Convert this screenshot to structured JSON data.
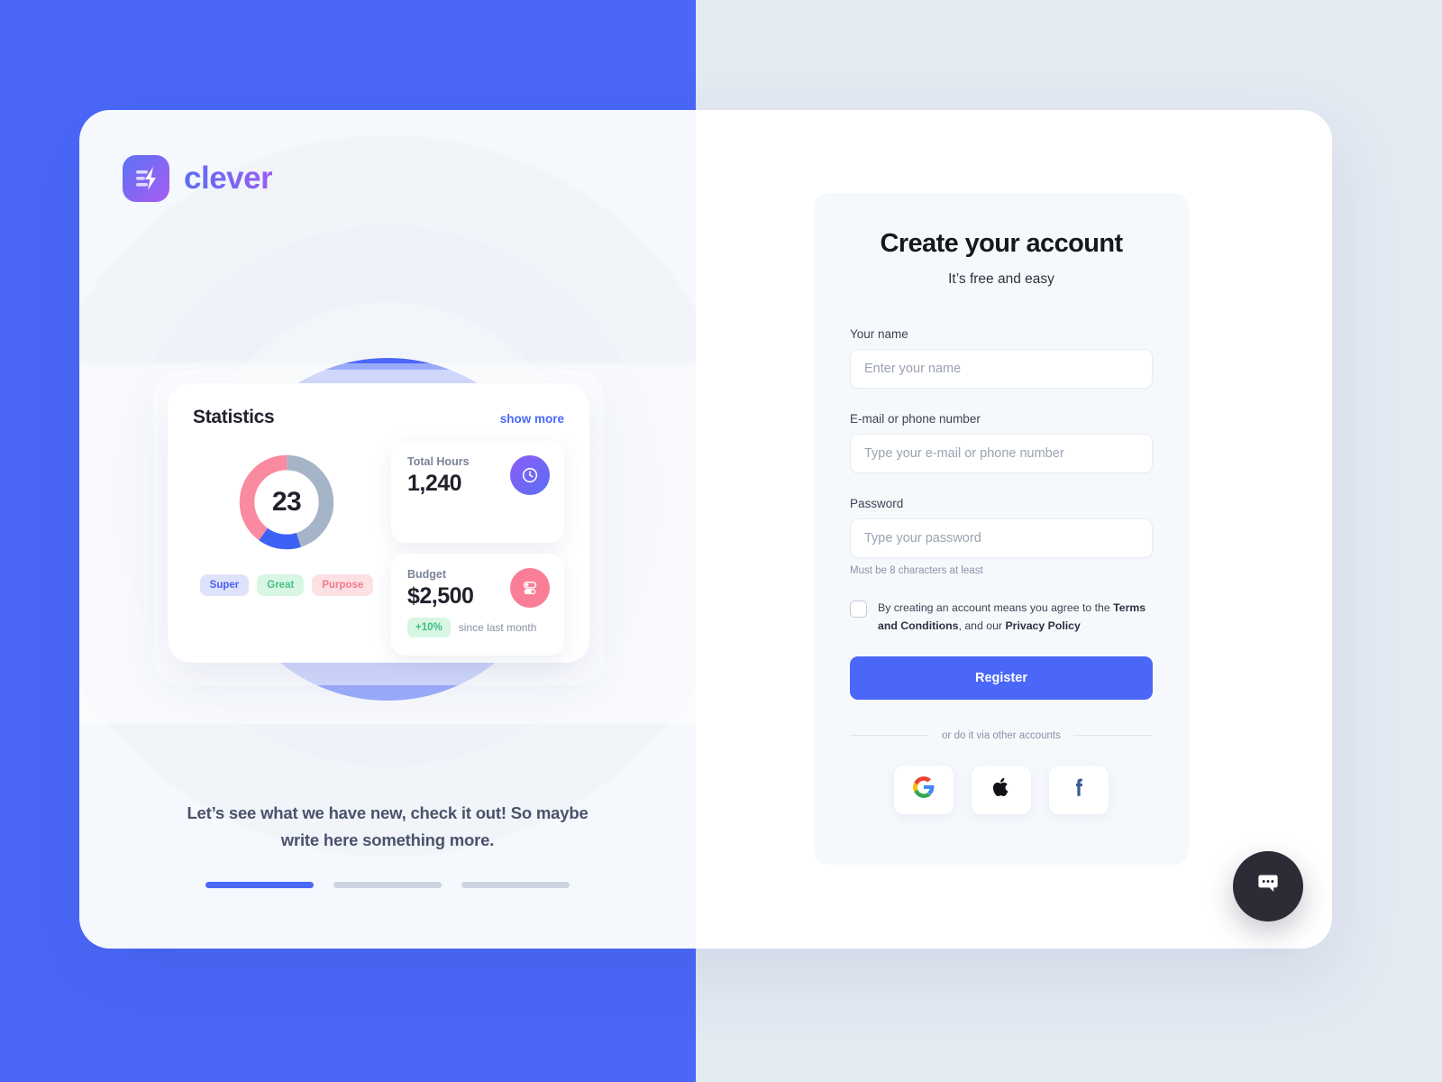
{
  "brand": {
    "name": "clever",
    "mark_icon": "lightning-bolt-icon"
  },
  "promo": {
    "stats": {
      "title": "Statistics",
      "show_more": "show more",
      "donut_value": "23",
      "tags": [
        {
          "label": "Super"
        },
        {
          "label": "Great"
        },
        {
          "label": "Purpose"
        }
      ],
      "metrics": [
        {
          "label": "Total Hours",
          "value": "1,240",
          "icon": "clock-icon"
        },
        {
          "label": "Budget",
          "value": "$2,500",
          "icon": "toggle-sliders-icon",
          "change": "+10%",
          "change_note": "since last month"
        }
      ]
    },
    "caption": "Let’s see what we have new, check it out! So maybe write here something more.",
    "pager": [
      {
        "active": true
      },
      {
        "active": false
      },
      {
        "active": false
      }
    ]
  },
  "form": {
    "title": "Create your account",
    "subtitle": "It’s free and easy",
    "fields": [
      {
        "label": "Your name",
        "placeholder": "Enter your name",
        "value": ""
      },
      {
        "label": "E-mail or phone number",
        "placeholder": "Type your e-mail or phone number",
        "value": ""
      },
      {
        "label": "Password",
        "placeholder": "Type your password",
        "value": ""
      }
    ],
    "password_hint": "Must be 8 characters at least",
    "terms": {
      "lead": "By creating an account means you agree to the ",
      "link1": "Terms and Conditions",
      "mid": ", and our ",
      "link2": "Privacy Policy",
      "checked": false
    },
    "submit_label": "Register",
    "divider_text": "or do it via other accounts",
    "social": [
      {
        "name": "google",
        "icon": "google-icon"
      },
      {
        "name": "apple",
        "icon": "apple-icon"
      },
      {
        "name": "facebook",
        "icon": "facebook-icon"
      }
    ]
  },
  "chat": {
    "icon": "chat-bubble-icon"
  },
  "colors": {
    "brand_blue": "#4a67f8",
    "brand_purple": "#9a5cf0",
    "page_left_bg": "#4a67f8",
    "page_right_bg": "#e4eaf2",
    "donut_gray": "#a6b4c8",
    "donut_pink": "#fa8a9f",
    "donut_blue": "#3e61f5",
    "positive_green": "#3dbd7d"
  },
  "chart_data": {
    "type": "pie",
    "title": "Statistics",
    "center_label": "23",
    "categories": [
      "Super",
      "Great",
      "Purpose"
    ],
    "values": [
      45,
      15,
      40
    ],
    "colors": [
      "#a6b4c8",
      "#3e61f5",
      "#fa8a9f"
    ],
    "legend_position": "bottom",
    "donut": true
  }
}
